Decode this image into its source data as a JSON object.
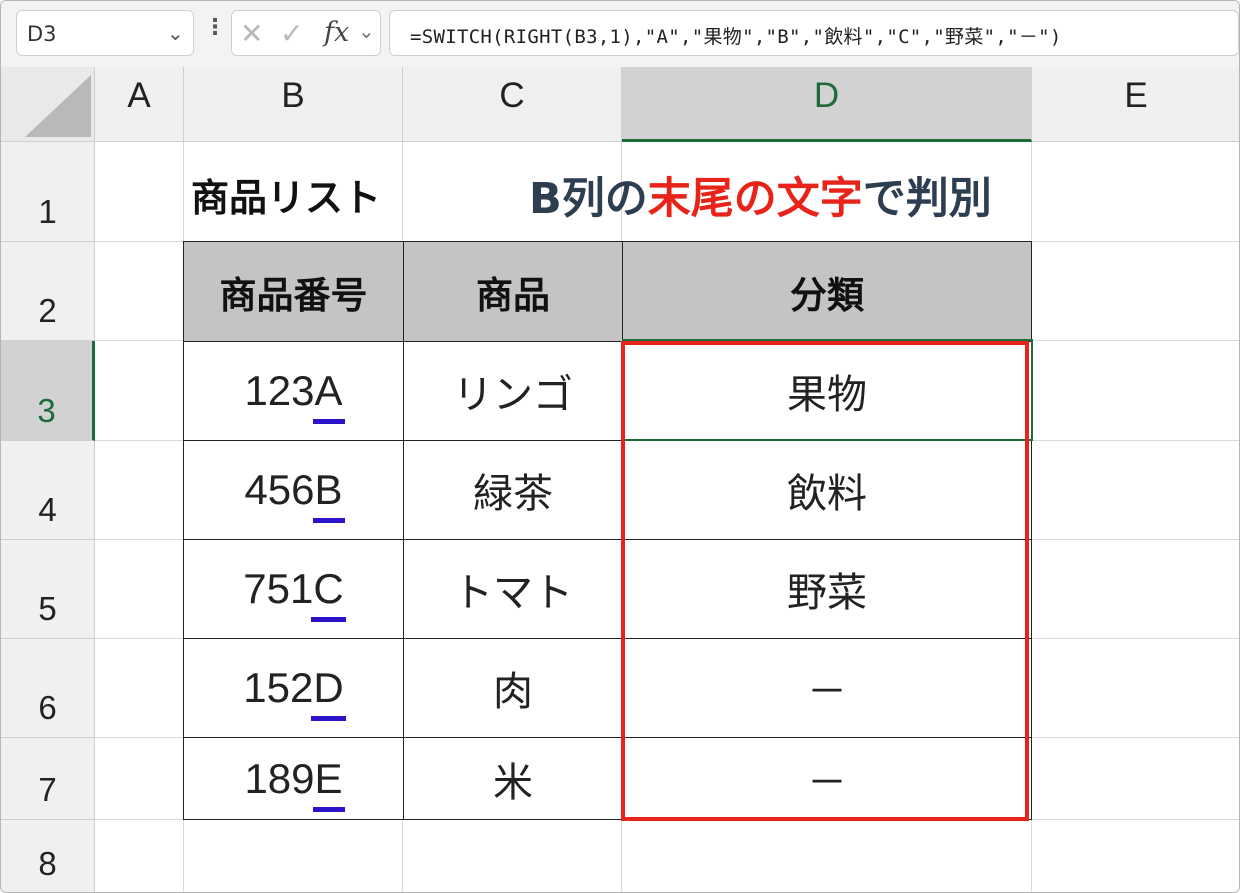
{
  "formula_bar": {
    "name_box": "D3",
    "cancel_icon": "✕",
    "enter_icon": "✓",
    "fx_label": "fx",
    "formula": "=SWITCH(RIGHT(B3,1),\"A\",\"果物\",\"B\",\"飲料\",\"C\",\"野菜\",\"－\")"
  },
  "columns": [
    "A",
    "B",
    "C",
    "D",
    "E"
  ],
  "selected_column": "D",
  "rows": [
    "1",
    "2",
    "3",
    "4",
    "5",
    "6",
    "7",
    "8"
  ],
  "selected_row": "3",
  "title": "商品リスト",
  "callout": {
    "prefix": "B列の",
    "highlight": "末尾の文字",
    "suffix": "で判別"
  },
  "table": {
    "headers": [
      "商品番号",
      "商品",
      "分類"
    ],
    "rows": [
      {
        "code_prefix": "123",
        "code_last": "A",
        "product": "リンゴ",
        "category": "果物"
      },
      {
        "code_prefix": "456",
        "code_last": "B",
        "product": "緑茶",
        "category": "飲料"
      },
      {
        "code_prefix": "751",
        "code_last": "C",
        "product": "トマト",
        "category": "野菜"
      },
      {
        "code_prefix": "152",
        "code_last": "D",
        "product": "肉",
        "category": "－"
      },
      {
        "code_prefix": "189",
        "code_last": "E",
        "product": "米",
        "category": "－"
      }
    ]
  },
  "colors": {
    "selection_green": "#1e6b3a",
    "highlight_red": "#e8231a",
    "underline_blue": "#2a13c9",
    "header_gray": "#c4c4c4"
  }
}
